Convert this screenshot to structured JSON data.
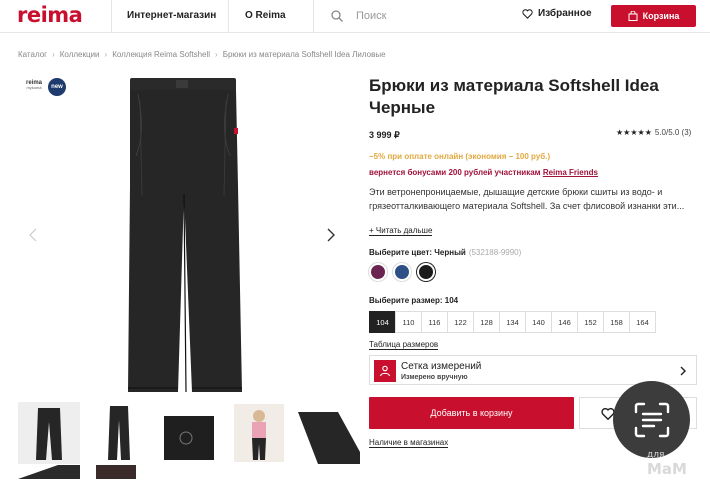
{
  "header": {
    "logo": "reima",
    "nav_shop": "Интернет-магазин",
    "nav_about": "О Reima",
    "search_placeholder": "Поиск",
    "favorites": "Избранное",
    "cart": "Корзина"
  },
  "breadcrumb": [
    "Каталог",
    "Коллекции",
    "Коллекция Reima Softshell",
    "Брюки из материала Softshell Idea Лиловые"
  ],
  "gallery": {
    "badge_brand": "reima",
    "badge_brand_sub": "mykuma",
    "badge_new": "new",
    "thumbnail_count": 5
  },
  "product": {
    "title": "Брюки из материала Softshell Idea Черные",
    "price": "3 999 ₽",
    "rating_stars": "★★★★★",
    "rating_text": "5.0/5.0 (3)",
    "rating_value": 5.0,
    "promo": "−5% при оплате онлайн (экономия − 100 руб.)",
    "bonus_prefix": "вернется бонусами 200 рублей участникам ",
    "bonus_link": "Reima Friends",
    "description": "Эти ветронепроницаемые, дышащие детские брюки сшиты из водо- и грязеотталкивающего материала Softshell. За счет флисовой изнанки эти...",
    "read_more": "+ Читать дальше",
    "color_label": "Выберите цвет: Черный",
    "color_code": "(532188-9990)",
    "colors": [
      "#6b2452",
      "#2e4f86",
      "#1b1b1b"
    ],
    "selected_color_index": 2,
    "size_label": "Выберите размер: 104",
    "sizes": [
      "104",
      "110",
      "116",
      "122",
      "128",
      "134",
      "140",
      "146",
      "152",
      "158",
      "164"
    ],
    "selected_size": "104",
    "size_table_link": "Таблица размеров",
    "measure_title": "Сетка измерений",
    "measure_sub": "Измерено вручную",
    "add_to_cart": "Добавить в корзину",
    "in_stores": "Наличие в магазинах"
  },
  "watermark": {
    "line1": "для",
    "line2": "МаМ"
  },
  "colors": {
    "brand": "#c8102e",
    "promo": "#e0a940",
    "bonus": "#a0123a"
  }
}
